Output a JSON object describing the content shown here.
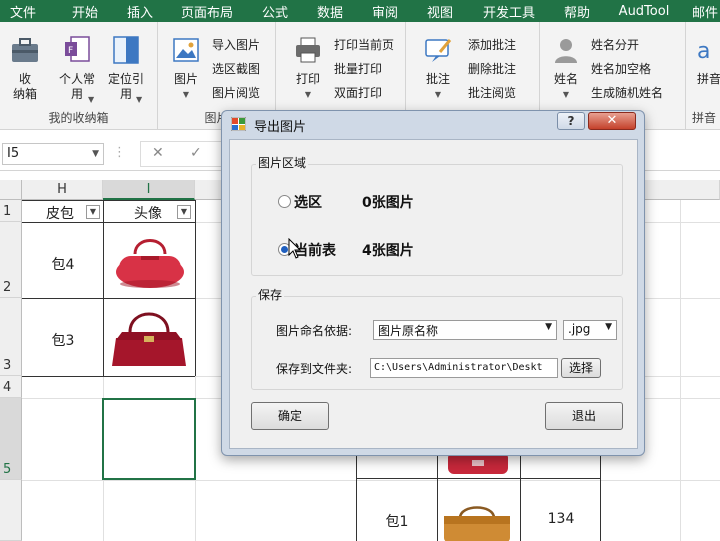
{
  "ribbon_tabs": [
    "文件",
    "开始",
    "插入",
    "页面布局",
    "公式",
    "数据",
    "审阅",
    "视图",
    "开发工具",
    "帮助",
    "AudTool",
    "邮件"
  ],
  "ribbon": {
    "group1": {
      "label": "我的收纳箱",
      "btn1": "收\n纳箱",
      "btn2": "个人常\n用",
      "btn3": "定位引\n用"
    },
    "group2": {
      "label": "图片",
      "big": "图片",
      "items": [
        "导入图片",
        "选区截图",
        "图片阅览"
      ]
    },
    "group3": {
      "big": "打印",
      "items": [
        "打印当前页",
        "批量打印",
        "双面打印"
      ]
    },
    "group4": {
      "big": "批注",
      "items": [
        "添加批注",
        "删除批注",
        "批注阅览"
      ]
    },
    "group5": {
      "big": "姓名",
      "items": [
        "姓名分开",
        "姓名加空格",
        "生成随机姓名"
      ]
    },
    "group6": {
      "big": "拼音",
      "label": "拼音"
    }
  },
  "formula_bar": {
    "name_box": "I5",
    "cancel": "✕",
    "enter": "✓"
  },
  "sheet": {
    "columns": [
      "H",
      "I"
    ],
    "rows": [
      "1",
      "2",
      "3",
      "4",
      "5"
    ],
    "header_h": "皮包",
    "header_i": "头像",
    "cells": [
      "包4",
      "包3"
    ],
    "below": {
      "label": "包1",
      "value": "134"
    }
  },
  "dialog": {
    "title": "导出图片",
    "help": "?",
    "close": "✕",
    "area_legend": "图片区域",
    "option1": "选区",
    "option1_count": "0张图片",
    "option2": "当前表",
    "option2_count": "4张图片",
    "save_legend": "保存",
    "naming_label": "图片命名依据:",
    "naming_value": "图片原名称",
    "ext_value": ".jpg",
    "folder_label": "保存到文件夹:",
    "folder_value": "C:\\Users\\Administrator\\Deskt",
    "browse": "选择",
    "ok": "确定",
    "exit": "退出"
  },
  "colors": {
    "excel_green": "#217346",
    "dialog_frame": "#cfd9e6",
    "close_red": "#c4412b",
    "bag_red": "#c8283b"
  }
}
